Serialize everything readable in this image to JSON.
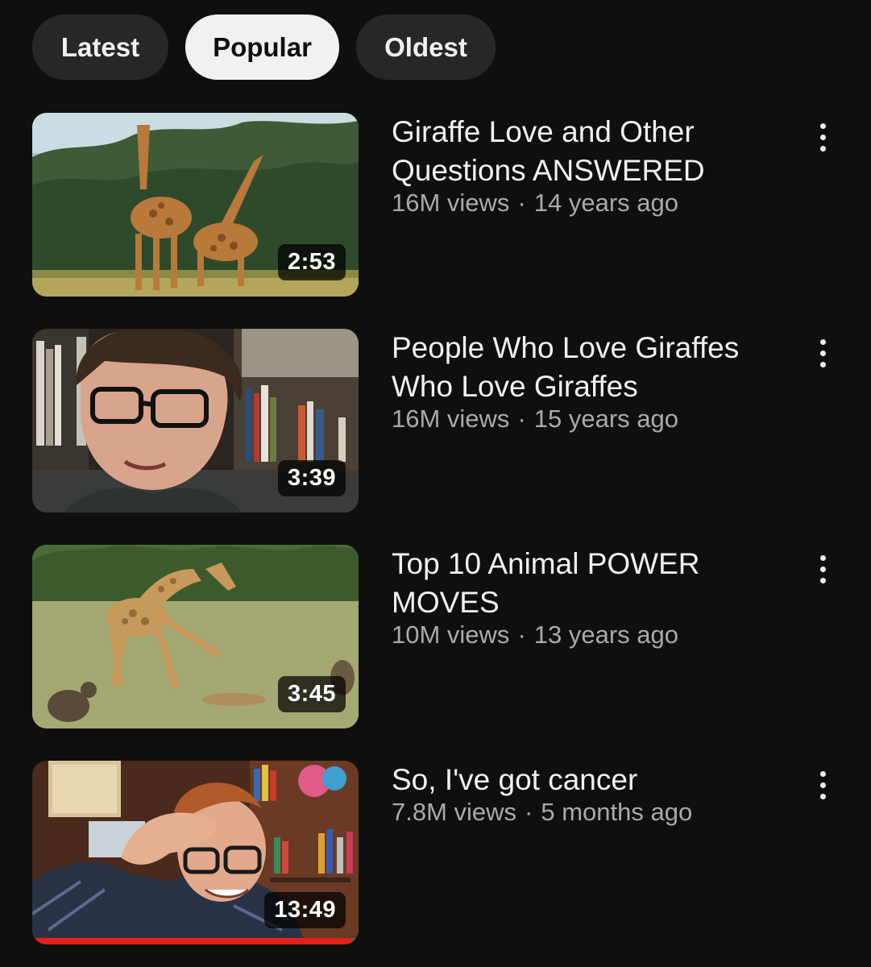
{
  "filters": [
    {
      "label": "Latest",
      "active": false
    },
    {
      "label": "Popular",
      "active": true
    },
    {
      "label": "Oldest",
      "active": false
    }
  ],
  "videos": [
    {
      "title": "Giraffe Love and Other Questions ANSWERED",
      "views": "16M views",
      "age": "14 years ago",
      "duration": "2:53",
      "thumbnail": "two giraffes in savanna"
    },
    {
      "title": "People Who Love Giraffes Who Love Giraffes",
      "views": "16M views",
      "age": "15 years ago",
      "duration": "3:39",
      "thumbnail": "man with glasses in front of bookshelf"
    },
    {
      "title": "Top 10 Animal POWER MOVES",
      "views": "10M views",
      "age": "13 years ago",
      "duration": "3:45",
      "thumbnail": "giraffe kicking hyenas"
    },
    {
      "title": "So, I've got cancer",
      "views": "7.8M views",
      "age": "5 months ago",
      "duration": "13:49",
      "thumbnail": "man holding forehead in colorful room",
      "watched_fraction": 0.98
    }
  ],
  "separator": "·",
  "colors": {
    "background": "#0f0f0f",
    "chip": "#272727",
    "chip_active": "#f1f1f1",
    "secondary_text": "#aaaaaa",
    "progress": "#e62117"
  }
}
